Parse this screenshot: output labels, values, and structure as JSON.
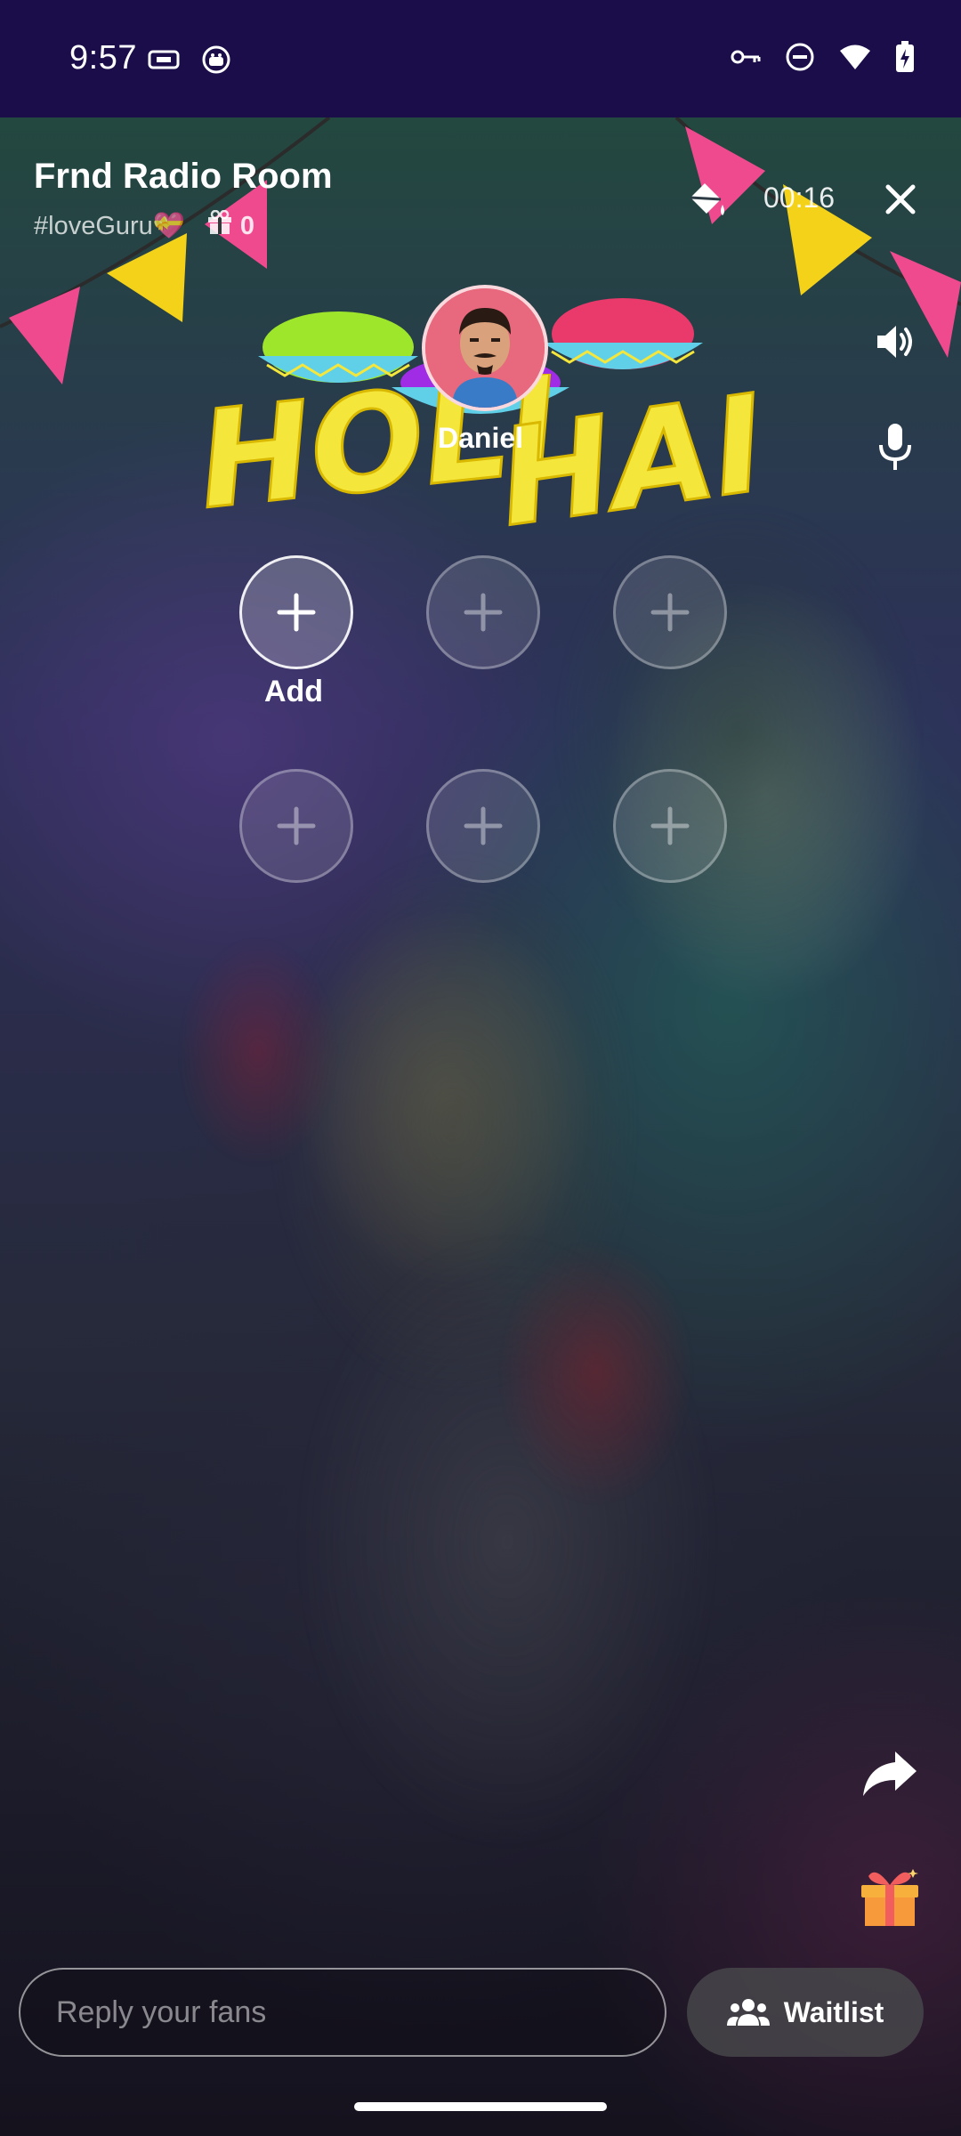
{
  "status_bar": {
    "time": "9:57",
    "icons": [
      "key-icon",
      "dnd-icon",
      "wifi-icon",
      "battery-charging-icon"
    ]
  },
  "room": {
    "title": "Frnd Radio Room",
    "tag": "#loveGuru💝",
    "gift_count": "0",
    "timer": "00:16"
  },
  "banner": {
    "text": "HOLI HAI"
  },
  "host": {
    "name": "Daniel"
  },
  "seats": {
    "add_label": "Add"
  },
  "bottom": {
    "reply_placeholder": "Reply your fans",
    "waitlist_label": "Waitlist"
  },
  "colors": {
    "status_bar": "#1b0d4a",
    "holi_yellow": "#f5e63c",
    "avatar_bg": "#e8697d",
    "gift_orange": "#f79a3b"
  }
}
